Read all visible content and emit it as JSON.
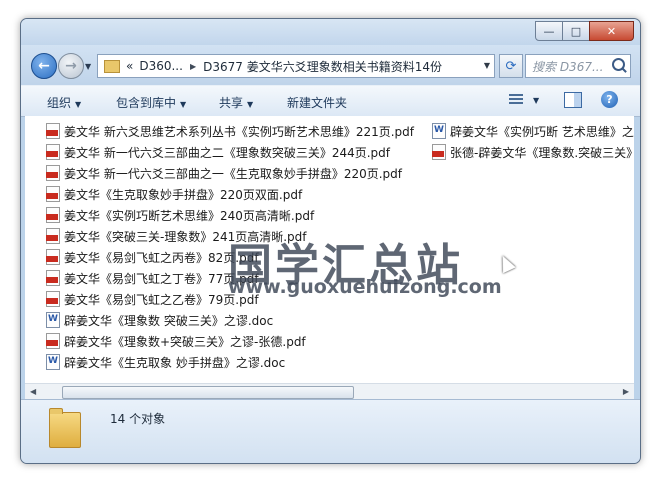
{
  "window": {
    "caption_buttons": {
      "minimize": "—",
      "maximize": "□",
      "close": "✕"
    }
  },
  "nav": {
    "back_glyph": "←",
    "forward_glyph": "→",
    "breadcrumb": [
      "«",
      "D360...",
      "D3677 姜文华六爻理象数相关书籍资料14份"
    ],
    "search_placeholder": "搜索 D367..."
  },
  "toolbar": {
    "organize": "组织",
    "include_in_library": "包含到库中",
    "share": "共享",
    "new_folder": "新建文件夹"
  },
  "files": [
    {
      "name": "姜文华 新六爻思维艺术系列丛书《实例巧断艺术思维》221页.pdf",
      "type": "pdf"
    },
    {
      "name": "姜文华 新一代六爻三部曲之二《理象数突破三关》244页.pdf",
      "type": "pdf"
    },
    {
      "name": "姜文华 新一代六爻三部曲之一《生克取象妙手拼盘》220页.pdf",
      "type": "pdf"
    },
    {
      "name": "姜文华《生克取象妙手拼盘》220页双面.pdf",
      "type": "pdf"
    },
    {
      "name": "姜文华《实例巧断艺术思维》240页高清晰.pdf",
      "type": "pdf"
    },
    {
      "name": "姜文华《突破三关-理象数》241页高清晰.pdf",
      "type": "pdf"
    },
    {
      "name": "姜文华《易剑飞虹之丙卷》82页.pdf",
      "type": "pdf"
    },
    {
      "name": "姜文华《易剑飞虹之丁卷》77页.pdf",
      "type": "pdf"
    },
    {
      "name": "姜文华《易剑飞虹之乙卷》79页.pdf",
      "type": "pdf"
    },
    {
      "name": "辟姜文华《理象数 突破三关》之谬.doc",
      "type": "doc"
    },
    {
      "name": "辟姜文华《理象数+突破三关》之谬-张德.pdf",
      "type": "pdf"
    },
    {
      "name": "辟姜文华《生克取象 妙手拼盘》之谬.doc",
      "type": "doc"
    },
    {
      "name": "辟姜文华《实例巧断 艺术思维》之",
      "type": "doc"
    },
    {
      "name": "张德-辟姜文华《理象数.突破三关》",
      "type": "pdf"
    }
  ],
  "watermark": {
    "chinese": "国学汇总站",
    "url": "www.guoxuehuizong.com"
  },
  "status": {
    "count_text": "14 个对象"
  }
}
